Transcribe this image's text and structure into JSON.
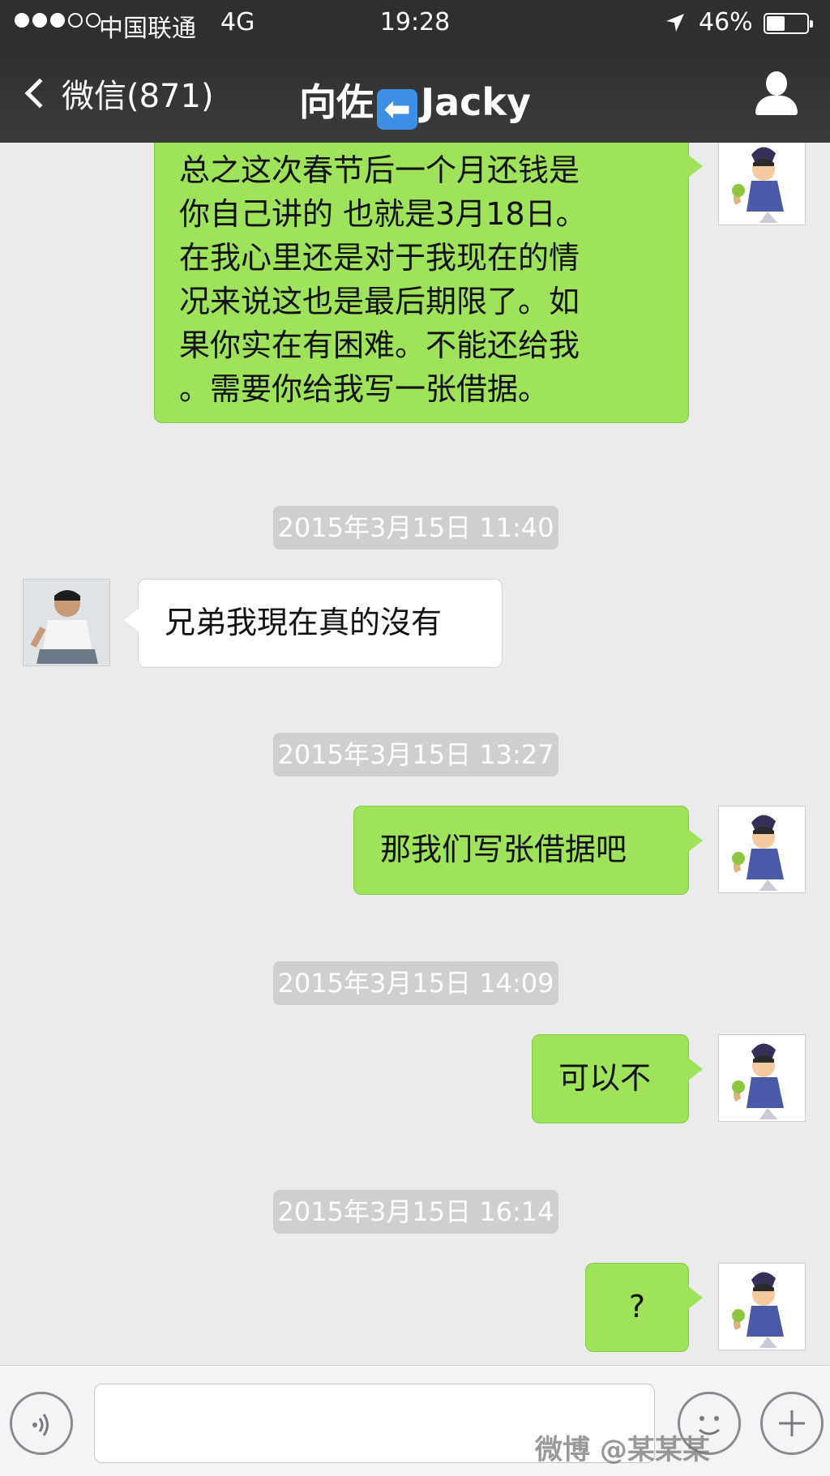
{
  "status_bar": {
    "carrier": "中国联通",
    "network": "4G",
    "time": "19:28",
    "battery_percent": "46%",
    "battery_level": 0.46,
    "signal_bars_filled": 3,
    "signal_bars_total": 5
  },
  "nav": {
    "back_label": "微信(871)",
    "title_prefix": "向佐",
    "title_arrow": "⬅",
    "title_suffix": "Jacky"
  },
  "messages": {
    "m1": {
      "direction": "sent",
      "text": "总之这次春节后一个月还钱是\n你自己讲的 也就是3月18日。\n在我心里还是对于我现在的情\n况来说这也是最后期限了。如\n果你实在有困难。不能还给我\n。需要你给我写一张借据。"
    },
    "t1": "2015年3月15日 11:40",
    "m2": {
      "direction": "received",
      "text": "兄弟我現在真的沒有"
    },
    "t2": "2015年3月15日 13:27",
    "m3": {
      "direction": "sent",
      "text": "那我们写张借据吧"
    },
    "t3": "2015年3月15日 14:09",
    "m4": {
      "direction": "sent",
      "text": "可以不"
    },
    "t4": "2015年3月15日 16:14",
    "m5": {
      "direction": "sent",
      "text": "?"
    }
  },
  "input_bar": {
    "placeholder": "",
    "watermark": "微博 @某某某"
  },
  "colors": {
    "sent_bubble": "#9ee35a",
    "received_bubble": "#ffffff",
    "chat_background": "#ebebeb",
    "nav_background": "#2e2f31",
    "timestamp_pill": "#cfcfcf"
  }
}
